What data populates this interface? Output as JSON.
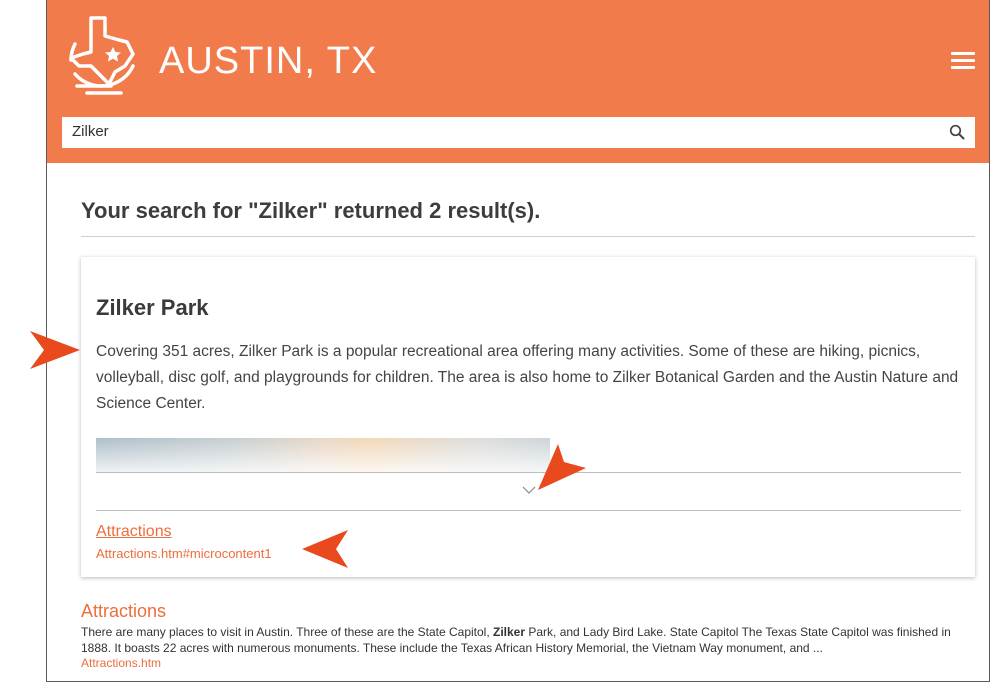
{
  "header": {
    "title": "AUSTIN, TX",
    "background": "#f27b4c",
    "logo_icon": "texas-map-logo",
    "menu_icon": "hamburger-menu-icon"
  },
  "search": {
    "value": "Zilker",
    "icon": "search-icon"
  },
  "results": {
    "heading": "Your search for \"Zilker\" returned 2 result(s)."
  },
  "featured": {
    "title": "Zilker Park",
    "body": "Covering 351 acres, Zilker Park is a popular recreational area offering many activities. Some of these are hiking, picnics, volleyball, disc golf, and playgrounds for children. The area is also home to Zilker Botanical Garden and the Austin Nature and Science Center.",
    "expand_icon": "chevron-down-icon",
    "link_label": "Attractions",
    "link_url": "Attractions.htm#microcontent1"
  },
  "result2": {
    "title": "Attractions",
    "body_before": "There are many places to visit in Austin. Three of these are the State Capitol, ",
    "body_bold": "Zilker",
    "body_after": " Park, and Lady Bird Lake. State Capitol The Texas State Capitol was finished in 1888. It boasts 22 acres with numerous monuments. These include the Texas African History Memorial, the Vietnam Way monument, and ...",
    "url": "Attractions.htm"
  },
  "colors": {
    "accent": "#ee6d3d",
    "callout": "#e8491d"
  }
}
